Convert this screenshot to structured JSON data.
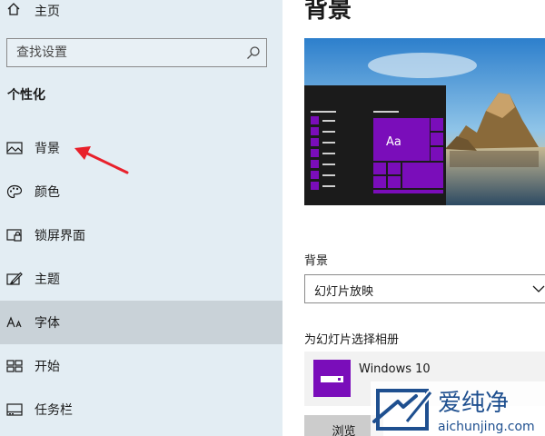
{
  "sidebar": {
    "home_label": "主页",
    "search_placeholder": "查找设置",
    "section_title": "个性化",
    "items": [
      {
        "label": "背景",
        "icon": "picture-icon"
      },
      {
        "label": "颜色",
        "icon": "palette-icon"
      },
      {
        "label": "锁屏界面",
        "icon": "lock-screen-icon"
      },
      {
        "label": "主题",
        "icon": "theme-brush-icon"
      },
      {
        "label": "字体",
        "icon": "font-icon",
        "selected": true
      },
      {
        "label": "开始",
        "icon": "start-menu-icon"
      },
      {
        "label": "任务栏",
        "icon": "taskbar-icon"
      }
    ]
  },
  "content": {
    "page_title": "背景",
    "preview_tile_text": "Aa",
    "background_label": "背景",
    "background_value": "幻灯片放映",
    "album_label": "为幻灯片选择相册",
    "album_name": "Windows 10",
    "browse_label": "浏览"
  },
  "watermark": {
    "brand": "爱纯净",
    "url": "aichunjing.com"
  },
  "colors": {
    "sidebar_bg": "#e3edf3",
    "selected_bg": "#c9d2d8",
    "accent_purple": "#7a0dba",
    "annotation_red": "#e8212b",
    "watermark_blue": "#1e4f8f"
  }
}
